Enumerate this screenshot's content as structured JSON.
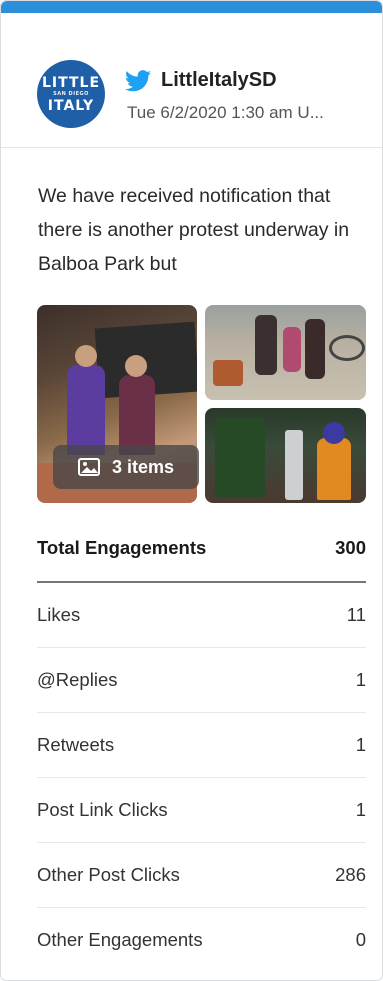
{
  "account": {
    "avatar_line1": "LITTLE",
    "avatar_line2": "SAN DIEGO",
    "avatar_line3": "ITALY",
    "handle": "LittleItalySD",
    "timestamp": "Tue 6/2/2020 1:30 am U..."
  },
  "post": {
    "text": "We have received notification that there is another protest underway in Balboa Park but",
    "media_badge": "3 items"
  },
  "stats": [
    {
      "label": "Total Engagements",
      "value": "300"
    },
    {
      "label": "Likes",
      "value": "11"
    },
    {
      "label": "@Replies",
      "value": "1"
    },
    {
      "label": "Retweets",
      "value": "1"
    },
    {
      "label": "Post Link Clicks",
      "value": "1"
    },
    {
      "label": "Other Post Clicks",
      "value": "286"
    },
    {
      "label": "Other Engagements",
      "value": "0"
    }
  ],
  "colors": {
    "accent": "#2b8fdc",
    "twitter_blue": "#1da1f2",
    "avatar_bg": "#1f5fa8"
  },
  "icons": {
    "network": "twitter-icon",
    "media": "image-icon"
  }
}
